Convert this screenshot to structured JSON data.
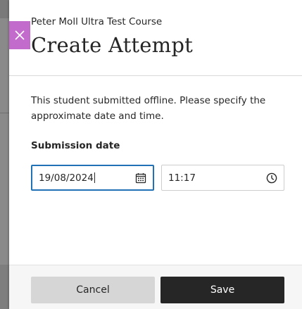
{
  "header": {
    "course_name": "Peter Moll Ultra Test Course",
    "title": "Create Attempt"
  },
  "body": {
    "instructions": "This student submitted offline. Please specify the approximate date and time.",
    "submission_label": "Submission date",
    "date_value": "19/08/2024",
    "time_value": "11:17"
  },
  "footer": {
    "cancel_label": "Cancel",
    "save_label": "Save"
  },
  "icons": {
    "close": "close-icon",
    "calendar": "calendar-icon",
    "clock": "clock-icon"
  },
  "colors": {
    "close_tab": "#c26bcc",
    "focus_border": "#2071b5",
    "save_button": "#262626",
    "cancel_button": "#d6d6d6"
  }
}
